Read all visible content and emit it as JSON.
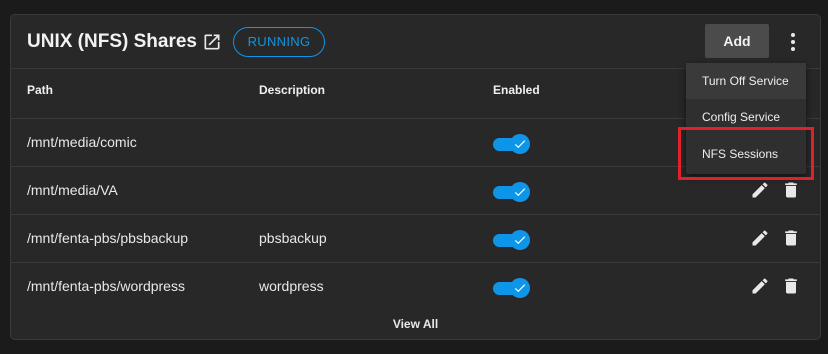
{
  "header": {
    "title": "UNIX (NFS) Shares",
    "status_badge": "RUNNING",
    "add_label": "Add",
    "external_link_icon": "external-link-icon",
    "more_icon": "more-vert-icon"
  },
  "table": {
    "columns": {
      "path": "Path",
      "description": "Description",
      "enabled": "Enabled"
    },
    "rows": [
      {
        "path": "/mnt/media/comic",
        "description": "",
        "enabled": true,
        "actions_visible": false
      },
      {
        "path": "/mnt/media/VA",
        "description": "",
        "enabled": true,
        "actions_visible": true
      },
      {
        "path": "/mnt/fenta-pbs/pbsbackup",
        "description": "pbsbackup",
        "enabled": true,
        "actions_visible": true
      },
      {
        "path": "/mnt/fenta-pbs/wordpress",
        "description": "wordpress",
        "enabled": true,
        "actions_visible": true
      }
    ],
    "edit_icon": "pencil-icon",
    "delete_icon": "trash-icon"
  },
  "footer": {
    "view_all": "View All"
  },
  "menu": {
    "items": [
      "Turn Off Service",
      "Config Service",
      "NFS Sessions"
    ],
    "highlighted_item": "NFS Sessions"
  },
  "colors": {
    "accent": "#0d95e8",
    "highlight_border": "#e0202a",
    "card_bg": "#282828"
  }
}
